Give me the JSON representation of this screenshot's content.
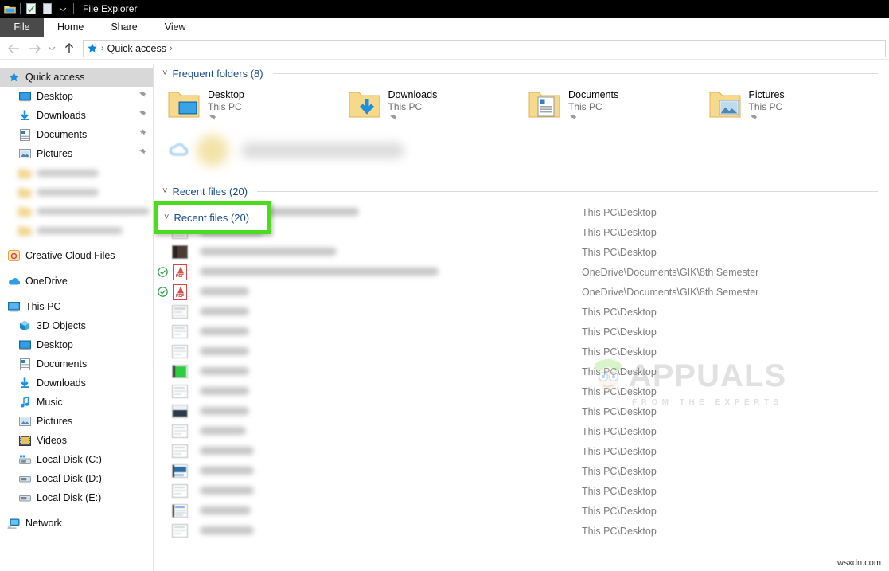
{
  "window": {
    "title": "File Explorer",
    "quick_access_toolbar": [
      "folder-icon",
      "properties-icon",
      "new-folder-icon",
      "chevron-down-icon"
    ]
  },
  "ribbon": {
    "file_tab": "File",
    "tabs": [
      "Home",
      "Share",
      "View"
    ]
  },
  "address_bar": {
    "back": "back-arrow-icon",
    "forward": "forward-arrow-icon",
    "recent": "chevron-down-icon",
    "up": "up-arrow-icon",
    "breadcrumb": [
      "Quick access"
    ]
  },
  "sidebar": {
    "items": [
      {
        "label": "Quick access",
        "icon": "star-pin-icon",
        "indent": 0,
        "selected": true,
        "pinned": false,
        "blurred": false
      },
      {
        "label": "Desktop",
        "icon": "desktop-icon",
        "indent": 1,
        "selected": false,
        "pinned": true,
        "blurred": false
      },
      {
        "label": "Downloads",
        "icon": "downloads-icon",
        "indent": 1,
        "selected": false,
        "pinned": true,
        "blurred": false
      },
      {
        "label": "Documents",
        "icon": "documents-icon",
        "indent": 1,
        "selected": false,
        "pinned": true,
        "blurred": false
      },
      {
        "label": "Pictures",
        "icon": "pictures-icon",
        "indent": 1,
        "selected": false,
        "pinned": true,
        "blurred": false
      },
      {
        "label": "",
        "icon": "folder-icon",
        "indent": 1,
        "selected": false,
        "pinned": false,
        "blurred": true,
        "blur_width": 78
      },
      {
        "label": "",
        "icon": "folder-icon",
        "indent": 1,
        "selected": false,
        "pinned": false,
        "blurred": true,
        "blur_width": 78
      },
      {
        "label": "",
        "icon": "folder-icon",
        "indent": 1,
        "selected": false,
        "pinned": false,
        "blurred": true,
        "blur_width": 142
      },
      {
        "label": "",
        "icon": "folder-icon",
        "indent": 1,
        "selected": false,
        "pinned": false,
        "blurred": true,
        "blur_width": 108
      },
      {
        "label": "Creative Cloud Files",
        "icon": "creative-cloud-icon",
        "indent": 0,
        "selected": false,
        "pinned": false,
        "blurred": false,
        "gap_before": true
      },
      {
        "label": "OneDrive",
        "icon": "onedrive-icon",
        "indent": 0,
        "selected": false,
        "pinned": false,
        "blurred": false,
        "gap_before": true
      },
      {
        "label": "This PC",
        "icon": "this-pc-icon",
        "indent": 0,
        "selected": false,
        "pinned": false,
        "blurred": false,
        "gap_before": true
      },
      {
        "label": "3D Objects",
        "icon": "3d-objects-icon",
        "indent": 1,
        "selected": false,
        "pinned": false,
        "blurred": false
      },
      {
        "label": "Desktop",
        "icon": "desktop-icon",
        "indent": 1,
        "selected": false,
        "pinned": false,
        "blurred": false
      },
      {
        "label": "Documents",
        "icon": "documents-icon",
        "indent": 1,
        "selected": false,
        "pinned": false,
        "blurred": false
      },
      {
        "label": "Downloads",
        "icon": "downloads-icon",
        "indent": 1,
        "selected": false,
        "pinned": false,
        "blurred": false
      },
      {
        "label": "Music",
        "icon": "music-icon",
        "indent": 1,
        "selected": false,
        "pinned": false,
        "blurred": false
      },
      {
        "label": "Pictures",
        "icon": "pictures-icon",
        "indent": 1,
        "selected": false,
        "pinned": false,
        "blurred": false
      },
      {
        "label": "Videos",
        "icon": "videos-icon",
        "indent": 1,
        "selected": false,
        "pinned": false,
        "blurred": false
      },
      {
        "label": "Local Disk (C:)",
        "icon": "system-drive-icon",
        "indent": 1,
        "selected": false,
        "pinned": false,
        "blurred": false
      },
      {
        "label": "Local Disk (D:)",
        "icon": "drive-icon",
        "indent": 1,
        "selected": false,
        "pinned": false,
        "blurred": false
      },
      {
        "label": "Local Disk (E:)",
        "icon": "drive-icon",
        "indent": 1,
        "selected": false,
        "pinned": false,
        "blurred": false
      },
      {
        "label": "Network",
        "icon": "network-icon",
        "indent": 0,
        "selected": false,
        "pinned": false,
        "blurred": false,
        "gap_before": true
      }
    ]
  },
  "main": {
    "frequent_folders": {
      "header": "Frequent folders (8)",
      "items": [
        {
          "name": "Desktop",
          "location": "This PC",
          "icon": "folder-desktop-icon",
          "pinned": true
        },
        {
          "name": "Downloads",
          "location": "This PC",
          "icon": "folder-downloads-icon",
          "pinned": true
        },
        {
          "name": "Documents",
          "location": "This PC",
          "icon": "folder-documents-icon",
          "pinned": true
        },
        {
          "name": "Pictures",
          "location": "This PC",
          "icon": "folder-pictures-icon",
          "pinned": true
        }
      ],
      "blurred_row": {
        "icon": "onedrive-icon",
        "blur_width": 205
      }
    },
    "recent_files": {
      "header": "Recent files (20)",
      "rows": [
        {
          "thumb": "image-thumb",
          "synced": false,
          "name_width": 200,
          "path": "This PC\\Desktop"
        },
        {
          "thumb": "image-thumb",
          "synced": false,
          "name_width": 80,
          "path": "This PC\\Desktop"
        },
        {
          "thumb": "dark-thumb",
          "synced": false,
          "name_width": 172,
          "path": "This PC\\Desktop"
        },
        {
          "thumb": "pdf-icon",
          "synced": true,
          "name_width": 300,
          "path": "OneDrive\\Documents\\GIK\\8th Semester"
        },
        {
          "thumb": "pdf-icon",
          "synced": true,
          "name_width": 62,
          "path": "OneDrive\\Documents\\GIK\\8th Semester"
        },
        {
          "thumb": "image-thumb",
          "synced": false,
          "name_width": 62,
          "path": "This PC\\Desktop"
        },
        {
          "thumb": "doc-thumb",
          "synced": false,
          "name_width": 62,
          "path": "This PC\\Desktop"
        },
        {
          "thumb": "doc-thumb",
          "synced": false,
          "name_width": 62,
          "path": "This PC\\Desktop"
        },
        {
          "thumb": "green-thumb",
          "synced": false,
          "name_width": 62,
          "path": "This PC\\Desktop"
        },
        {
          "thumb": "doc-thumb",
          "synced": false,
          "name_width": 62,
          "path": "This PC\\Desktop"
        },
        {
          "thumb": "dark-band-thumb",
          "synced": false,
          "name_width": 62,
          "path": "This PC\\Desktop"
        },
        {
          "thumb": "doc-thumb",
          "synced": false,
          "name_width": 58,
          "path": "This PC\\Desktop"
        },
        {
          "thumb": "doc-thumb",
          "synced": false,
          "name_width": 68,
          "path": "This PC\\Desktop"
        },
        {
          "thumb": "blue-thumb",
          "synced": false,
          "name_width": 68,
          "path": "This PC\\Desktop"
        },
        {
          "thumb": "doc-thumb",
          "synced": false,
          "name_width": 68,
          "path": "This PC\\Desktop"
        },
        {
          "thumb": "text-thumb",
          "synced": false,
          "name_width": 64,
          "path": "This PC\\Desktop"
        },
        {
          "thumb": "doc-thumb",
          "synced": false,
          "name_width": 68,
          "path": "This PC\\Desktop"
        }
      ]
    }
  },
  "annotation": {
    "highlight_target": "Recent files (20)",
    "color": "#4ddb1f"
  },
  "watermarks": {
    "brand": "APPUALS",
    "tagline": "FROM THE EXPERTS",
    "corner": "wsxdn.com"
  }
}
